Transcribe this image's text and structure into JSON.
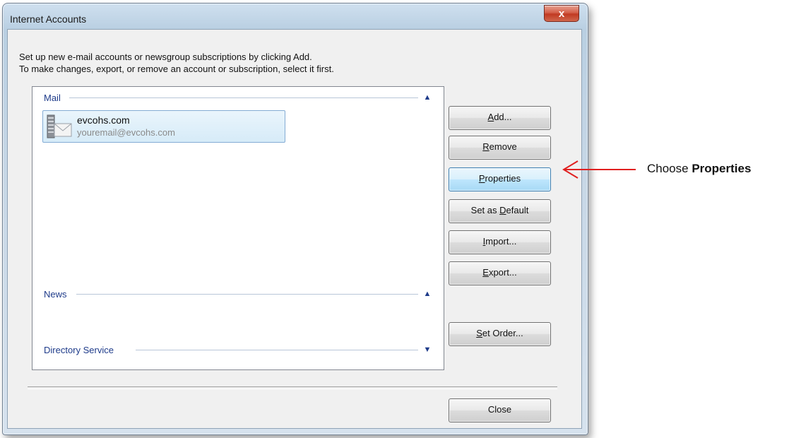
{
  "window": {
    "title": "Internet Accounts",
    "close_glyph": "x"
  },
  "instructions": {
    "line1": "Set up new e-mail accounts or newsgroup subscriptions by clicking Add.",
    "line2": "To make changes, export, or remove an account or subscription, select it first."
  },
  "groups": {
    "mail": {
      "label": "Mail",
      "state": "expanded"
    },
    "news": {
      "label": "News",
      "state": "expanded"
    },
    "directory": {
      "label": "Directory Service",
      "state": "collapsed"
    }
  },
  "account": {
    "name": "evcohs.com",
    "email": "youremail@evcohs.com",
    "icon": "mail-account-icon"
  },
  "buttons": {
    "add": {
      "pre": "",
      "u": "A",
      "post": "dd..."
    },
    "remove": {
      "pre": "",
      "u": "R",
      "post": "emove"
    },
    "properties": {
      "pre": "",
      "u": "P",
      "post": "roperties"
    },
    "set_default": {
      "pre": "Set as ",
      "u": "D",
      "post": "efault"
    },
    "import": {
      "pre": "",
      "u": "I",
      "post": "mport..."
    },
    "export": {
      "pre": "",
      "u": "E",
      "post": "xport..."
    },
    "set_order": {
      "pre": "",
      "u": "S",
      "post": "et Order..."
    },
    "close": {
      "pre": "Close",
      "u": "",
      "post": ""
    }
  },
  "annotation": {
    "prefix": "Choose ",
    "emphasis": "Properties",
    "arrow_color": "#e02020"
  },
  "colors": {
    "group_header": "#1e3b8a",
    "selection": "#d6ebf8",
    "focused_button": "#bee6fd"
  }
}
